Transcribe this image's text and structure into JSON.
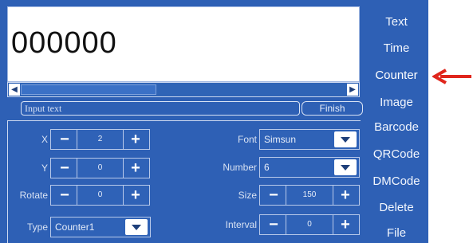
{
  "display": {
    "text": "000000"
  },
  "input": {
    "placeholder": "Input text",
    "finish_label": "Finish"
  },
  "controls": {
    "x": {
      "label": "X",
      "value": "2"
    },
    "y": {
      "label": "Y",
      "value": "0"
    },
    "rotate": {
      "label": "Rotate",
      "value": "0"
    },
    "type": {
      "label": "Type",
      "value": "Counter1"
    },
    "font": {
      "label": "Font",
      "value": "Simsun"
    },
    "number": {
      "label": "Number",
      "value": "6"
    },
    "size": {
      "label": "Size",
      "value": "150"
    },
    "interval": {
      "label": "Interval",
      "value": "0"
    }
  },
  "sidebar": {
    "items": [
      {
        "label": "Text"
      },
      {
        "label": "Time"
      },
      {
        "label": "Counter"
      },
      {
        "label": "Image"
      },
      {
        "label": "Barcode"
      },
      {
        "label": "QRCode"
      },
      {
        "label": "DMCode"
      },
      {
        "label": "Delete"
      },
      {
        "label": "File"
      }
    ],
    "active": "Counter"
  },
  "colors": {
    "panel_bg": "#2e60b5",
    "pointer_arrow": "#e0261c"
  }
}
